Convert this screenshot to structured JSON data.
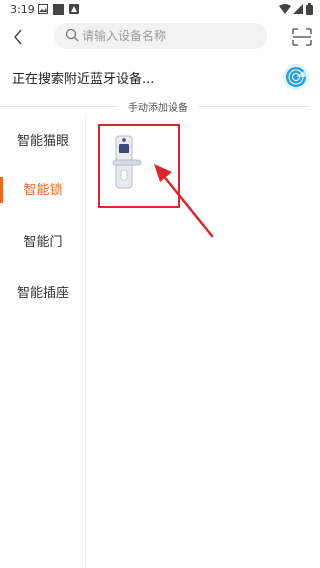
{
  "status_bar": {
    "time": "3:19"
  },
  "header": {
    "search_placeholder": "请输入设备名称"
  },
  "scan": {
    "status_text": "正在搜索附近蓝牙设备..."
  },
  "section": {
    "manual_add_label": "手动添加设备"
  },
  "sidebar": {
    "items": [
      {
        "label": "智能猫眼"
      },
      {
        "label": "智能锁"
      },
      {
        "label": "智能门"
      },
      {
        "label": "智能插座"
      }
    ],
    "active_index": 1
  },
  "colors": {
    "accent": "#f06a1d",
    "highlight_box": "#d7282f",
    "radar": "#2a9fd8"
  }
}
